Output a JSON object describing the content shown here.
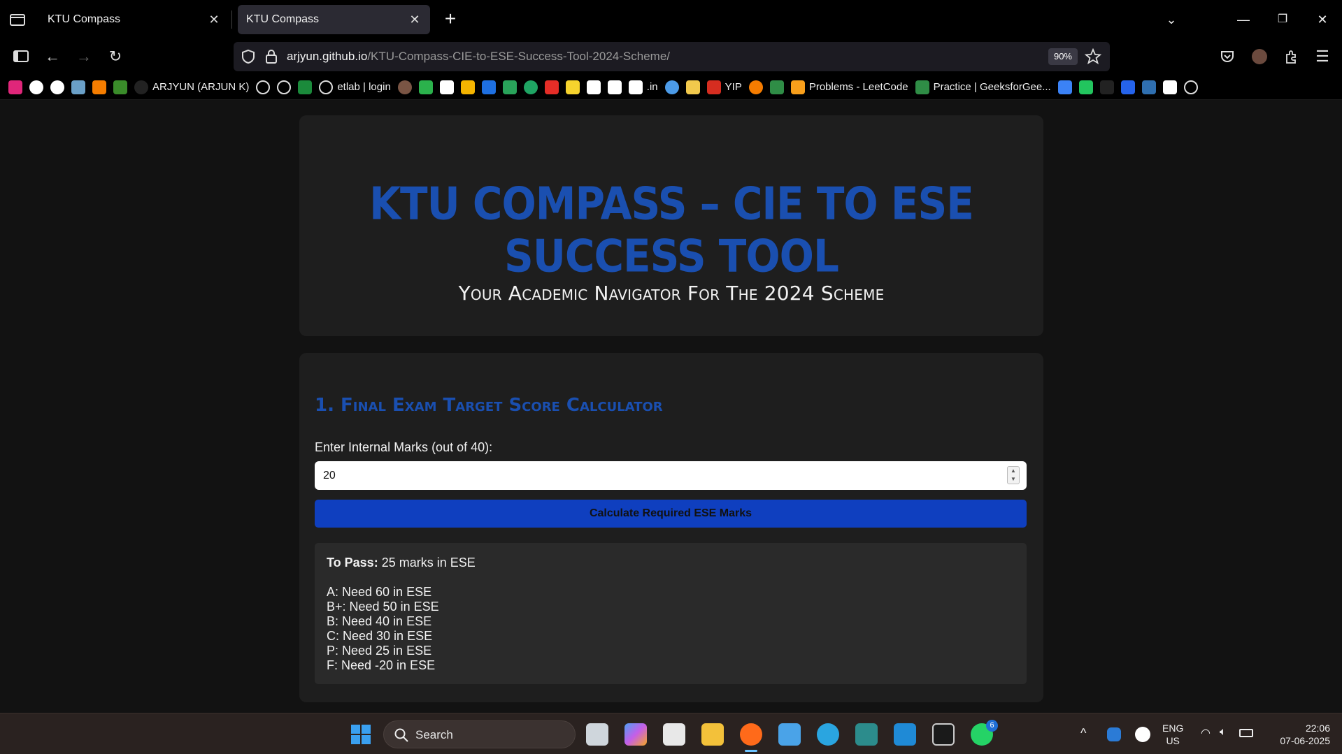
{
  "browser": {
    "tabs": [
      {
        "label": "KTU Compass",
        "active": false
      },
      {
        "label": "KTU Compass",
        "active": true
      }
    ],
    "url": {
      "host": "arjyun.github.io",
      "path": "/KTU-Compass-CIE-to-ESE-Success-Tool-2024-Scheme/"
    },
    "zoom": "90%",
    "bookmarks": {
      "arjyun": "ARJYUN (ARJUN K)",
      "etlab": "etlab | login",
      "amazon": ".in",
      "yip": "YIP",
      "leetcode": "Problems - LeetCode",
      "gfg": "Practice | GeeksforGee..."
    }
  },
  "page": {
    "title": "KTU COMPASS – CIE TO ESE SUCCESS TOOL",
    "subtitle": "Your Academic Navigator For The 2024 Scheme",
    "calculator": {
      "heading": "1. Final Exam Target Score Calculator",
      "input_label": "Enter Internal Marks (out of 40):",
      "input_value": "20",
      "button_label": "Calculate Required ESE Marks",
      "result": {
        "pass_label": "To Pass:",
        "pass_value": "25 marks in ESE",
        "grades": [
          "A: Need 60 in ESE",
          "B+: Need 50 in ESE",
          "B: Need 40 in ESE",
          "C: Need 30 in ESE",
          "P: Need 25 in ESE",
          "F: Need -20 in ESE"
        ]
      }
    }
  },
  "taskbar": {
    "search_label": "Search",
    "whatsapp_badge": "6",
    "language": {
      "line1": "ENG",
      "line2": "US"
    },
    "clock": {
      "time": "22:06",
      "date": "07-06-2025"
    }
  }
}
